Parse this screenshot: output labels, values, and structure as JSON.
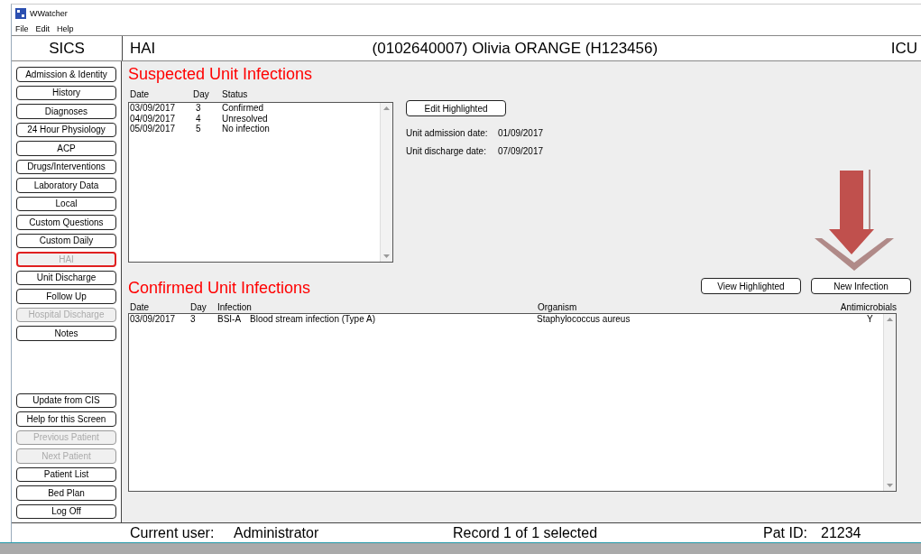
{
  "window": {
    "title": "WWatcher"
  },
  "menu": [
    "File",
    "Edit",
    "Help"
  ],
  "header": {
    "app": "SICS",
    "screen": "HAI",
    "patient": "(0102640007) Olivia ORANGE (H123456)",
    "unit": "ICU"
  },
  "nav": [
    {
      "label": "Admission & Identity",
      "selected": false,
      "disabled": false
    },
    {
      "label": "History",
      "selected": false,
      "disabled": false
    },
    {
      "label": "Diagnoses",
      "selected": false,
      "disabled": false
    },
    {
      "label": "24 Hour Physiology",
      "selected": false,
      "disabled": false
    },
    {
      "label": "ACP",
      "selected": false,
      "disabled": false
    },
    {
      "label": "Drugs/Interventions",
      "selected": false,
      "disabled": false
    },
    {
      "label": "Laboratory Data",
      "selected": false,
      "disabled": false
    },
    {
      "label": "Local",
      "selected": false,
      "disabled": false
    },
    {
      "label": "Custom Questions",
      "selected": false,
      "disabled": false
    },
    {
      "label": "Custom Daily",
      "selected": false,
      "disabled": false
    },
    {
      "label": "HAI",
      "selected": true,
      "disabled": true
    },
    {
      "label": "Unit Discharge",
      "selected": false,
      "disabled": false
    },
    {
      "label": "Follow Up",
      "selected": false,
      "disabled": false
    },
    {
      "label": "Hospital Discharge",
      "selected": false,
      "disabled": true
    },
    {
      "label": "Notes",
      "selected": false,
      "disabled": false
    }
  ],
  "actions": [
    {
      "label": "Update from CIS",
      "disabled": false
    },
    {
      "label": "Help for this Screen",
      "disabled": false
    },
    {
      "label": "Previous Patient",
      "disabled": true
    },
    {
      "label": "Next Patient",
      "disabled": true
    },
    {
      "label": "Patient List",
      "disabled": false
    },
    {
      "label": "Bed Plan",
      "disabled": false
    },
    {
      "label": "Log Off",
      "disabled": false
    }
  ],
  "suspected": {
    "title": "Suspected Unit Infections",
    "columns": [
      "Date",
      "Day",
      "Status"
    ],
    "rows": [
      {
        "date": "03/09/2017",
        "day": "3",
        "status": "Confirmed"
      },
      {
        "date": "04/09/2017",
        "day": "4",
        "status": "Unresolved"
      },
      {
        "date": "05/09/2017",
        "day": "5",
        "status": "No infection"
      }
    ],
    "button": "Edit Highlighted",
    "fields": [
      {
        "label": "Unit admission date:",
        "value": "01/09/2017"
      },
      {
        "label": "Unit discharge date:",
        "value": "07/09/2017"
      }
    ]
  },
  "confirmed": {
    "title": "Confirmed Unit Infections",
    "buttons": [
      "View Highlighted",
      "New Infection"
    ],
    "columns": [
      "Date",
      "Day",
      "Infection",
      "Organism",
      "Antimicrobials"
    ],
    "rows": [
      {
        "date": "03/09/2017",
        "day": "3",
        "code": "BSI-A",
        "infection": "Blood stream infection (Type A)",
        "organism": "Staphylococcus aureus",
        "antimicrobials": "Y"
      }
    ]
  },
  "status_bar": {
    "user_label": "Current user:",
    "user": "Administrator",
    "record": "Record 1 of 1 selected",
    "pat_label": "Pat ID:",
    "pat_id": "21234"
  }
}
